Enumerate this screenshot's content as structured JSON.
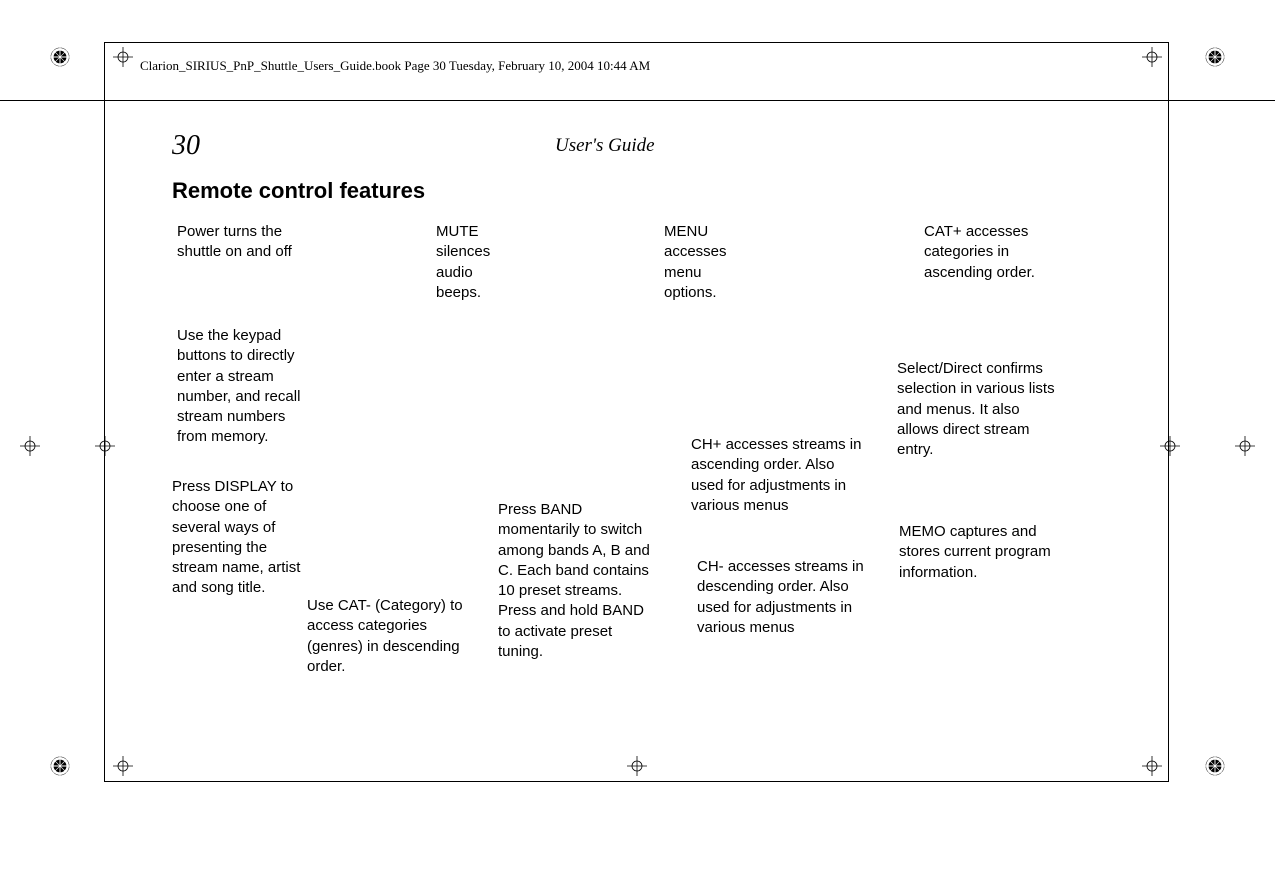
{
  "header": {
    "bookmark": "Clarion_SIRIUS_PnP_Shuttle_Users_Guide.book  Page 30  Tuesday, February 10, 2004  10:44 AM",
    "pageNumber": "30",
    "guideTitle": "User's Guide"
  },
  "section": {
    "title": "Remote control features"
  },
  "blocks": {
    "power": "Power turns the shuttle on and off",
    "mute": "MUTE silences audio beeps.",
    "menu": "MENU accesses menu options.",
    "catPlus": "CAT+ accesses categories in ascending order.",
    "keypad": "Use the keypad buttons to directly enter a stream number, and recall stream numbers from memory.",
    "selectDirect": "Select/Direct confirms selection in various lists and menus. It also allows direct stream entry.",
    "display": "Press DISPLAY to choose one of several ways of presenting the stream name, artist and song title.",
    "chPlus": "CH+ accesses streams in ascending order. Also used for adjustments in various menus",
    "memo": "MEMO captures and stores current program information.",
    "chMinus": "CH- accesses streams in descending order. Also used for adjustments in various menus",
    "catMinus": "Use CAT- (Category) to access categories (genres) in descending order.",
    "band": "Press BAND momentarily to switch among bands A, B and C. Each band contains 10 preset streams. Press and hold BAND to activate preset tuning."
  }
}
